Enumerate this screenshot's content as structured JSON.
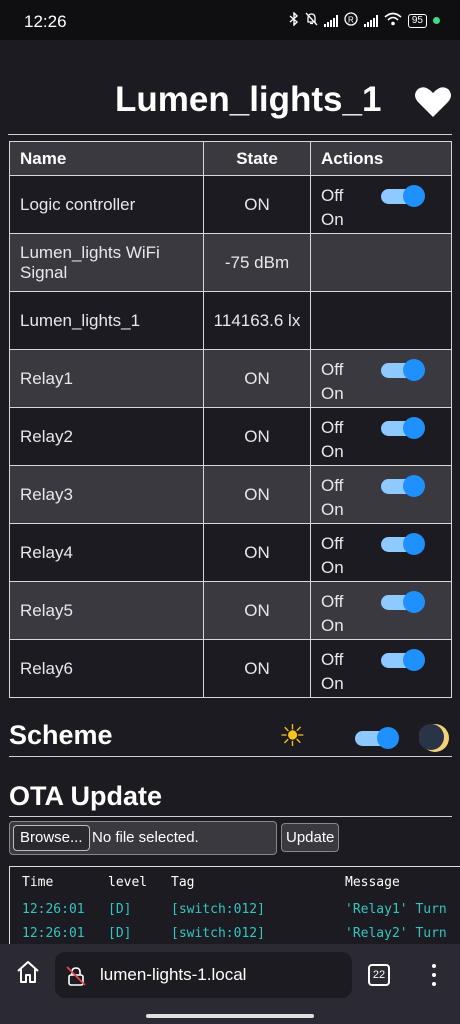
{
  "status_bar": {
    "time": "12:26",
    "battery": "95"
  },
  "page": {
    "title": "Lumen_lights_1",
    "table": {
      "headers": [
        "Name",
        "State",
        "Actions"
      ],
      "rows": [
        {
          "name": "Logic controller",
          "state": "ON",
          "off": "Off",
          "on": "On",
          "toggle": true
        },
        {
          "name": "Lumen_lights WiFi Signal",
          "state": "-75 dBm"
        },
        {
          "name": "Lumen_lights_1",
          "state": "114163.6 lx"
        },
        {
          "name": "Relay1",
          "state": "ON",
          "off": "Off",
          "on": "On",
          "toggle": true
        },
        {
          "name": "Relay2",
          "state": "ON",
          "off": "Off",
          "on": "On",
          "toggle": true
        },
        {
          "name": "Relay3",
          "state": "ON",
          "off": "Off",
          "on": "On",
          "toggle": true
        },
        {
          "name": "Relay4",
          "state": "ON",
          "off": "Off",
          "on": "On",
          "toggle": true
        },
        {
          "name": "Relay5",
          "state": "ON",
          "off": "Off",
          "on": "On",
          "toggle": true
        },
        {
          "name": "Relay6",
          "state": "ON",
          "off": "Off",
          "on": "On",
          "toggle": true
        }
      ]
    },
    "scheme": {
      "heading": "Scheme",
      "sun_icon": "☀"
    },
    "ota": {
      "heading": "OTA Update",
      "browse_label": "Browse...",
      "file_status": "No file selected.",
      "update_label": "Update"
    },
    "log": {
      "headers": [
        "Time",
        "level",
        "Tag",
        "Message"
      ],
      "lines": [
        [
          "12:26:01",
          "[D]",
          "[switch:012]",
          "'Relay1' Turn"
        ],
        [
          "12:26:01",
          "[D]",
          "[switch:012]",
          "'Relay2' Turn"
        ]
      ]
    }
  },
  "browser": {
    "url": "lumen-lights-1.local",
    "tab_count": "22"
  },
  "colors": {
    "background": "#1c1b22",
    "row_alt": "#3a393f",
    "toggle_on": "#1e90ff",
    "log_text": "#35c5c0"
  }
}
